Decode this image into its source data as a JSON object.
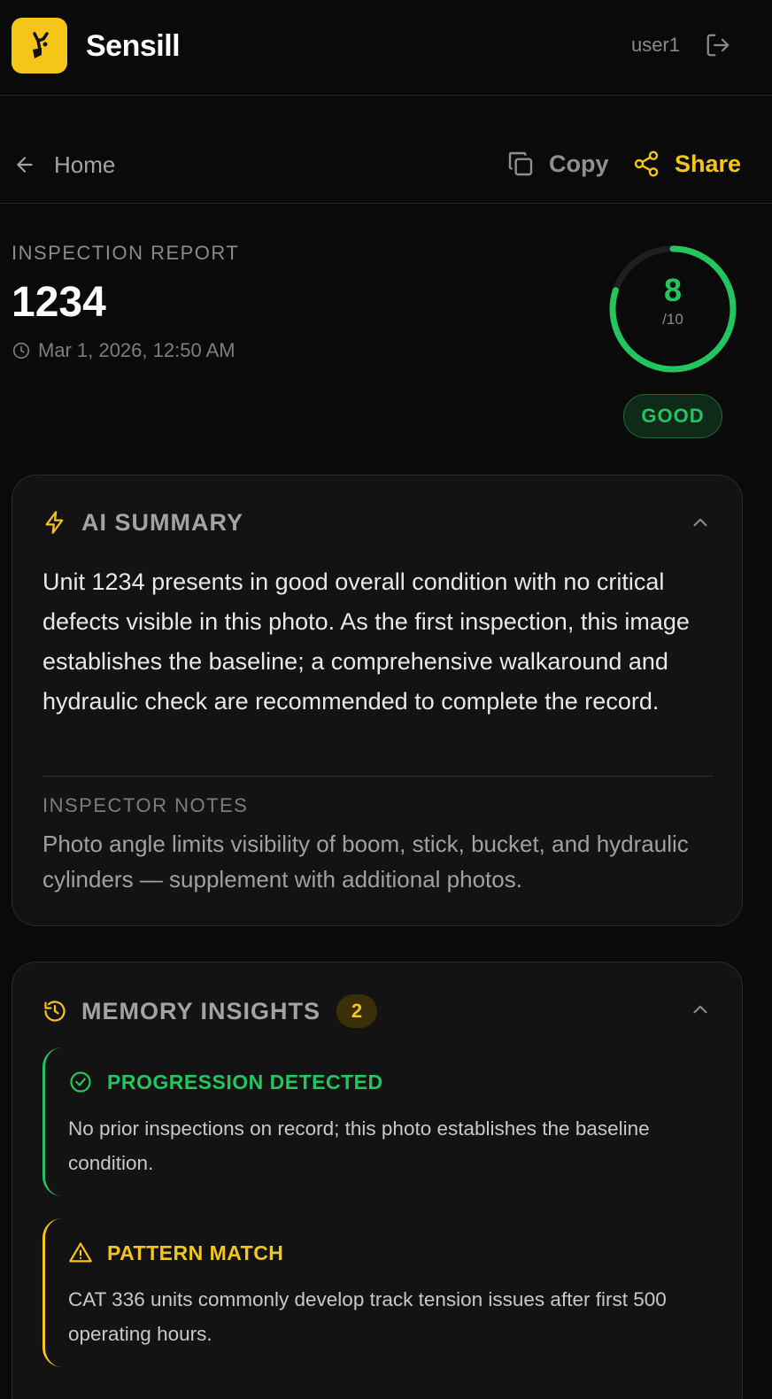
{
  "app": {
    "brand": "Sensill",
    "user": "user1"
  },
  "nav": {
    "back_label": "Home",
    "copy_label": "Copy",
    "share_label": "Share"
  },
  "report": {
    "eyebrow": "INSPECTION REPORT",
    "id": "1234",
    "timestamp": "Mar 1, 2026, 12:50 AM",
    "score": "8",
    "score_max": "/10",
    "score_fraction": 0.8,
    "rating": "GOOD"
  },
  "ai_summary": {
    "title": "AI SUMMARY",
    "text": "Unit 1234 presents in good overall condition with no critical defects visible in this photo. As the first inspection, this image establishes the baseline; a comprehensive walkaround and hydraulic check are recommended to complete the record.",
    "notes_label": "INSPECTOR NOTES",
    "notes_text": "Photo angle limits visibility of boom, stick, bucket, and hydraulic cylinders — supplement with additional photos."
  },
  "memory": {
    "title": "MEMORY INSIGHTS",
    "count": "2",
    "insights": [
      {
        "title": "PROGRESSION DETECTED",
        "text": "No prior inspections on record; this photo establishes the baseline condition."
      },
      {
        "title": "PATTERN MATCH",
        "text": "CAT 336 units commonly develop track tension issues after first 500 operating hours."
      }
    ]
  },
  "colors": {
    "accent": "#f5c518",
    "good": "#22c55e",
    "background": "#0a0a0a",
    "card": "#131313"
  },
  "icons": {
    "logo": "excavator-logo-icon",
    "logout": "logout-icon",
    "back": "arrow-left-icon",
    "copy": "copy-icon",
    "share": "share-icon",
    "clock": "clock-icon",
    "ai": "lightning-icon",
    "memory": "history-icon",
    "progression": "check-circle-icon",
    "pattern": "warning-triangle-icon",
    "collapse": "chevron-up-icon"
  }
}
